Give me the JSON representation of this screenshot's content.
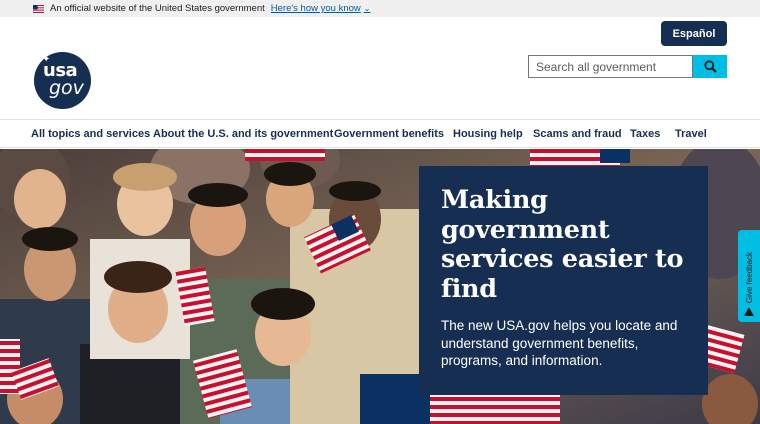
{
  "banner": {
    "text": "An official website of the United States government",
    "link": "Here's how you know"
  },
  "header": {
    "logo_top": "usa",
    "logo_bottom": "gov",
    "language_button": "Español",
    "search_placeholder": "Search all government"
  },
  "nav": [
    "All topics and services",
    "About the U.S. and its government",
    "Government benefits",
    "Housing help",
    "Scams and fraud",
    "Taxes",
    "Travel"
  ],
  "hero": {
    "title": "Making government services easier to find",
    "text": "The new USA.gov helps you locate and understand government benefits, programs, and information."
  },
  "feedback": {
    "label": "Give feedback"
  },
  "colors": {
    "navy": "#162e51",
    "cyan": "#00bde3",
    "link": "#005ea2"
  },
  "icons": [
    "us-flag-icon",
    "chevron-down-icon",
    "search-icon",
    "feedback-icon"
  ]
}
